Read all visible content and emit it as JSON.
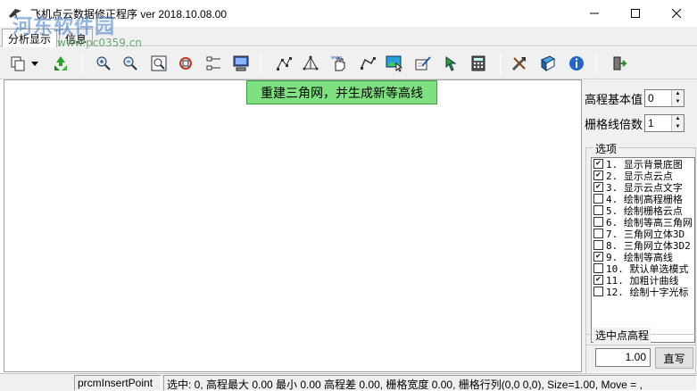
{
  "window": {
    "title": "飞机点云数据修正程序 ver 2018.10.08.00",
    "minimize_icon": "minimize-icon",
    "maximize_icon": "maximize-icon",
    "close_icon": "close-icon"
  },
  "watermark": {
    "text": "河东软件园",
    "url": "www.pc0359.cn"
  },
  "tabs": [
    {
      "label": "分析显示",
      "active": true
    },
    {
      "label": "信息",
      "active": false
    }
  ],
  "toolbar": {
    "buttons": [
      {
        "icon": "copy-icon"
      },
      {
        "icon": "dropdown-arrow-icon"
      },
      {
        "icon": "recycle-icon"
      },
      {
        "icon": "zoom-in-icon"
      },
      {
        "icon": "zoom-out-icon"
      },
      {
        "icon": "zoom-window-icon"
      },
      {
        "icon": "zoom-extent-icon"
      },
      {
        "icon": "node-tree-icon"
      },
      {
        "icon": "computer-icon"
      },
      {
        "icon": "points-icon"
      },
      {
        "icon": "triangle-icon"
      },
      {
        "icon": "hand-select-icon"
      },
      {
        "icon": "polyline-icon"
      },
      {
        "icon": "image-select-icon"
      },
      {
        "icon": "edit-point-icon"
      },
      {
        "icon": "arrow-icon"
      },
      {
        "icon": "calculator-icon"
      },
      {
        "icon": "tools-icon"
      },
      {
        "icon": "book-icon"
      },
      {
        "icon": "info-icon"
      },
      {
        "icon": "exit-icon"
      }
    ]
  },
  "tooltip": "重建三角网，并生成新等高线",
  "panel": {
    "base_elevation": {
      "label": "高程基本值",
      "value": "0"
    },
    "grid_multiple": {
      "label": "栅格线倍数",
      "value": "1"
    },
    "options_title": "选项",
    "options": [
      {
        "label": "1. 显示背景底图",
        "checked": true
      },
      {
        "label": "2. 显示点云点",
        "checked": true
      },
      {
        "label": "3. 显示云点文字",
        "checked": true
      },
      {
        "label": "4. 绘制高程栅格",
        "checked": false
      },
      {
        "label": "5. 绘制栅格云点",
        "checked": false
      },
      {
        "label": "6. 绘制等高三角网",
        "checked": false
      },
      {
        "label": "7. 三角网立体3D",
        "checked": false
      },
      {
        "label": "8. 三角网立体3D2",
        "checked": false
      },
      {
        "label": "9. 绘制等高线",
        "checked": true
      },
      {
        "label": "10. 默认单选模式",
        "checked": false
      },
      {
        "label": "11. 加粗计曲线",
        "checked": true
      },
      {
        "label": "12. 绘制十字光标",
        "checked": false
      }
    ],
    "selected_elevation_title": "选中点高程",
    "selected_elevation_value": "1.00",
    "direct_write_button": "直写"
  },
  "statusbar": {
    "mode": "prcmInsertPoint",
    "info": "选中: 0, 高程最大 0.00 最小 0.00 高程差 0.00, 栅格宽度 0.00, 栅格行列(0,0  0,0), Size=1.00, Move = ,"
  }
}
